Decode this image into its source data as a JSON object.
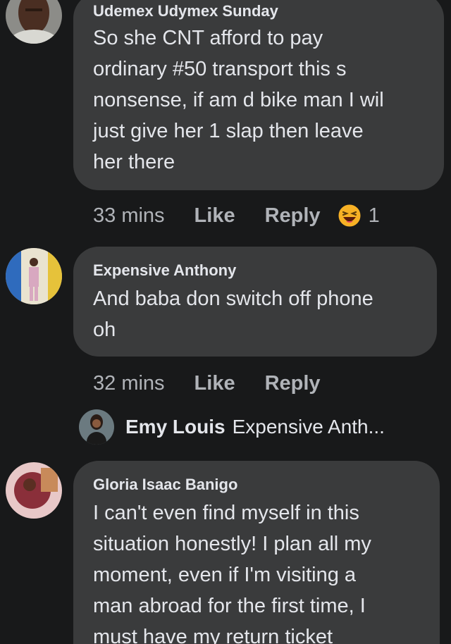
{
  "comments": [
    {
      "author": "Udemex Udymex Sunday",
      "lines": [
        "So she CNT afford to pay",
        "ordinary #50 transport this s",
        "nonsense, if am d bike man I wil",
        "just give her 1 slap then leave",
        "her there"
      ],
      "time": "33 mins",
      "like_label": "Like",
      "reply_label": "Reply",
      "reaction_icon": "haha-emoji-icon",
      "reaction_count": "1"
    },
    {
      "author": "Expensive Anthony",
      "lines": [
        "And baba don switch off phone",
        "oh"
      ],
      "time": "32 mins",
      "like_label": "Like",
      "reply_label": "Reply"
    },
    {
      "author": "Gloria Isaac Banigo",
      "lines": [
        "I can't even find myself in this",
        "situation honestly!  I plan all my",
        "moment, even if I'm visiting a",
        "man abroad for the first time, I",
        "must have my return ticket"
      ]
    }
  ],
  "reply_preview": {
    "author": "Emy Louis",
    "snippet": "Expensive Anth..."
  },
  "colors": {
    "background": "#18191a",
    "bubble": "#3a3b3c",
    "primary_text": "#e4e6eb",
    "secondary_text": "#b0b3b8"
  }
}
